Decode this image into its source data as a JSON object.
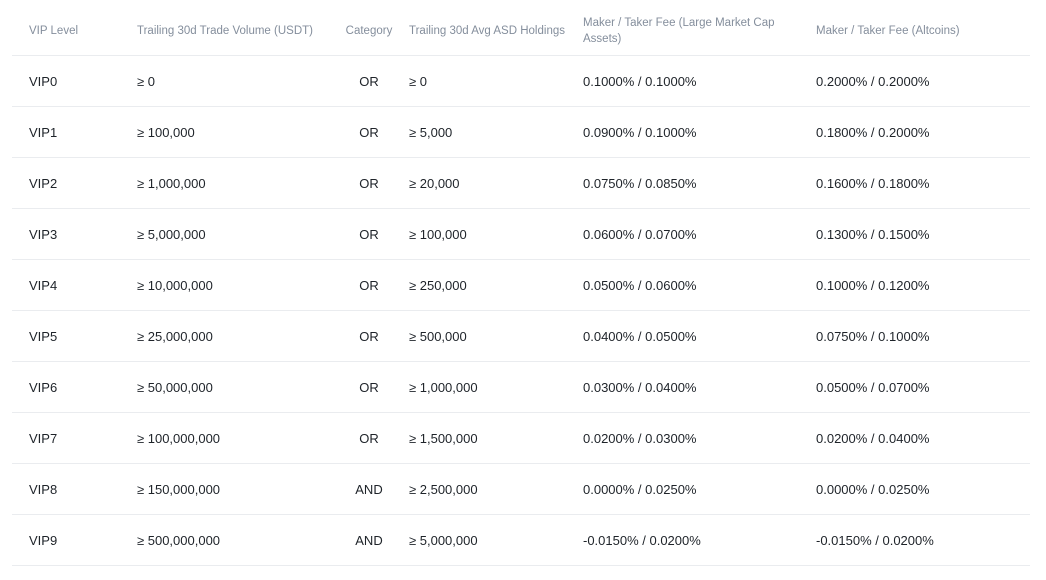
{
  "table": {
    "headers": [
      "VIP Level",
      "Trailing 30d Trade Volume (USDT)",
      "Category",
      "Trailing 30d Avg ASD Holdings",
      "Maker / Taker Fee (Large Market Cap Assets)",
      "Maker / Taker Fee (Altcoins)"
    ],
    "rows": [
      [
        "VIP0",
        "≥ 0",
        "OR",
        "≥ 0",
        "0.1000% / 0.1000%",
        "0.2000% / 0.2000%"
      ],
      [
        "VIP1",
        "≥ 100,000",
        "OR",
        "≥ 5,000",
        "0.0900% / 0.1000%",
        "0.1800% / 0.2000%"
      ],
      [
        "VIP2",
        "≥ 1,000,000",
        "OR",
        "≥ 20,000",
        "0.0750% / 0.0850%",
        "0.1600% / 0.1800%"
      ],
      [
        "VIP3",
        "≥ 5,000,000",
        "OR",
        "≥ 100,000",
        "0.0600% / 0.0700%",
        "0.1300% / 0.1500%"
      ],
      [
        "VIP4",
        "≥ 10,000,000",
        "OR",
        "≥ 250,000",
        "0.0500% / 0.0600%",
        "0.1000% / 0.1200%"
      ],
      [
        "VIP5",
        "≥ 25,000,000",
        "OR",
        "≥ 500,000",
        "0.0400% / 0.0500%",
        "0.0750% / 0.1000%"
      ],
      [
        "VIP6",
        "≥ 50,000,000",
        "OR",
        "≥ 1,000,000",
        "0.0300% / 0.0400%",
        "0.0500% / 0.0700%"
      ],
      [
        "VIP7",
        "≥ 100,000,000",
        "OR",
        "≥ 1,500,000",
        "0.0200% / 0.0300%",
        "0.0200% / 0.0400%"
      ],
      [
        "VIP8",
        "≥ 150,000,000",
        "AND",
        "≥ 2,500,000",
        "0.0000% / 0.0250%",
        "0.0000% / 0.0250%"
      ],
      [
        "VIP9",
        "≥ 500,000,000",
        "AND",
        "≥ 5,000,000",
        "-0.0150% / 0.0200%",
        "-0.0150% / 0.0200%"
      ]
    ]
  },
  "colors": {
    "header_text": "#848e9c",
    "body_text": "#1e2329",
    "divider": "#eaecef",
    "background": "#ffffff"
  }
}
